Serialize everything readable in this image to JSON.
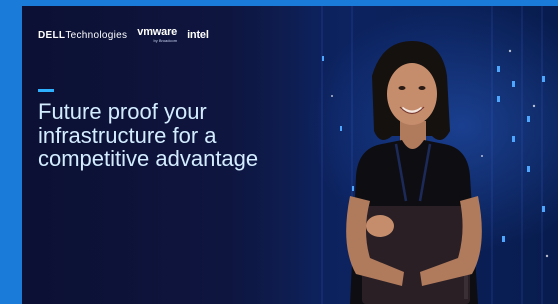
{
  "brand": {
    "dell": "DELL",
    "technologies": "Technologies",
    "vmware": "vmware",
    "vmware_byline": "by Broadcom",
    "intel": "intel"
  },
  "headline": {
    "line1": "Future proof your",
    "line2": "infrastructure for a",
    "line3": "competitive advantage"
  },
  "colors": {
    "page_background": "#1a7bd8",
    "headline_text": "#d3ecff",
    "accent_bar": "#2fb0ff"
  }
}
